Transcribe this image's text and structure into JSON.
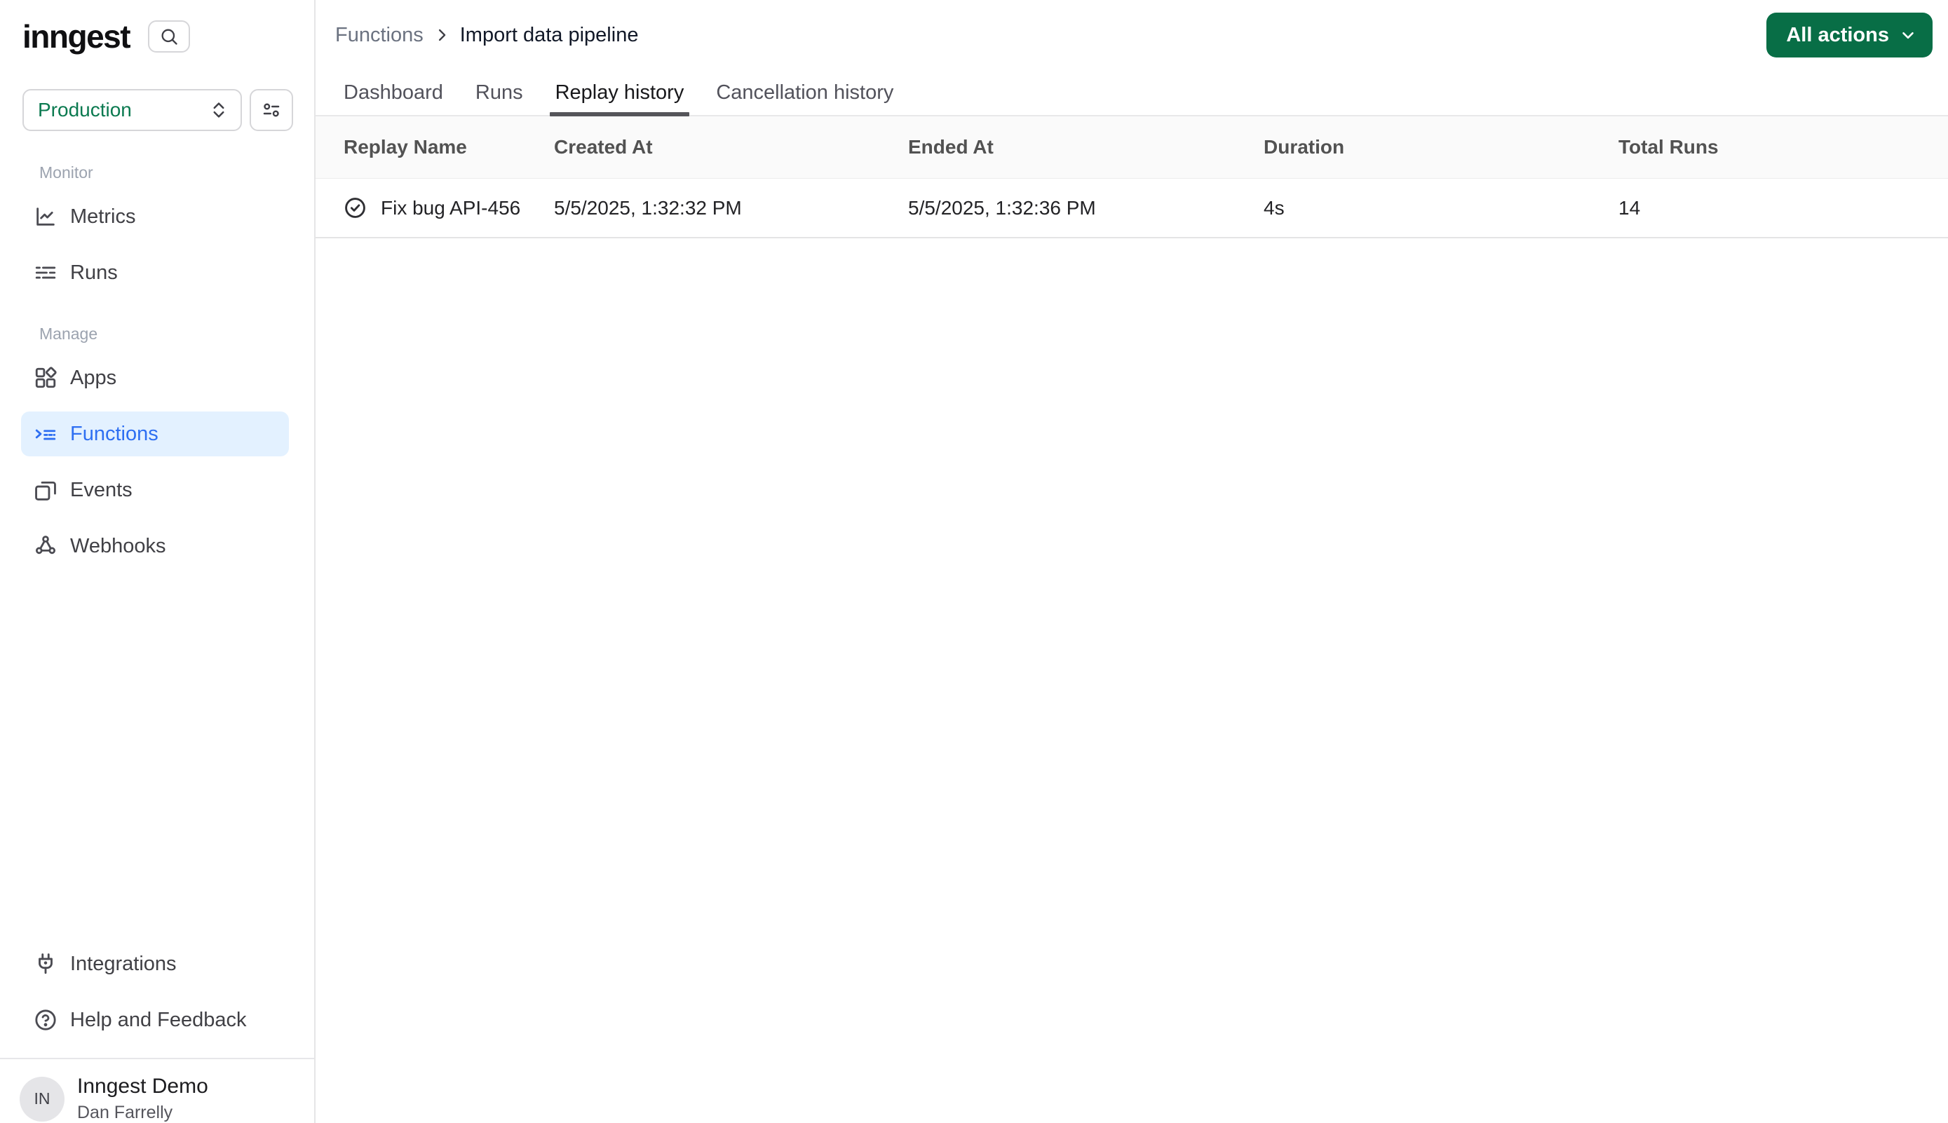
{
  "app": {
    "logo_text": "inngest"
  },
  "colors": {
    "primary_green": "#086e46",
    "env_green": "#0b7a50",
    "active_blue": "#2e6ff2",
    "active_blue_bg": "#e3f1ff",
    "header_band_bg": "#fafafa",
    "border_gray": "#e5e5e6"
  },
  "sidebar": {
    "search_icon": "search-icon",
    "environment": {
      "selected": "Production",
      "chevron_icon": "chevron-up-down-icon",
      "filter_icon": "sliders-icon"
    },
    "sections": [
      {
        "label": "Monitor",
        "items": [
          {
            "label": "Metrics",
            "icon": "chart-line-icon",
            "active": false
          },
          {
            "label": "Runs",
            "icon": "list-icon",
            "active": false
          }
        ]
      },
      {
        "label": "Manage",
        "items": [
          {
            "label": "Apps",
            "icon": "apps-icon",
            "active": false
          },
          {
            "label": "Functions",
            "icon": "functions-icon",
            "active": true
          },
          {
            "label": "Events",
            "icon": "events-icon",
            "active": false
          },
          {
            "label": "Webhooks",
            "icon": "webhooks-icon",
            "active": false
          }
        ]
      }
    ],
    "footer_items": [
      {
        "label": "Integrations",
        "icon": "plug-icon"
      },
      {
        "label": "Help and Feedback",
        "icon": "help-circle-icon"
      }
    ],
    "user": {
      "initials": "IN",
      "org": "Inngest Demo",
      "name": "Dan Farrelly"
    }
  },
  "header": {
    "breadcrumb": [
      "Functions",
      "Import data pipeline"
    ],
    "separator_icon": "chevron-right-icon",
    "actions_button": "All actions",
    "actions_chevron_icon": "chevron-down-icon"
  },
  "tabs": [
    {
      "label": "Dashboard",
      "active": false
    },
    {
      "label": "Runs",
      "active": false
    },
    {
      "label": "Replay history",
      "active": true
    },
    {
      "label": "Cancellation history",
      "active": false
    }
  ],
  "table": {
    "columns": [
      "Replay Name",
      "Created At",
      "Ended At",
      "Duration",
      "Total Runs"
    ],
    "rows": [
      {
        "status_icon": "check-circle-icon",
        "name": "Fix bug API-456",
        "created_at": "5/5/2025, 1:32:32 PM",
        "ended_at": "5/5/2025, 1:32:36 PM",
        "duration": "4s",
        "total_runs": "14"
      }
    ]
  }
}
